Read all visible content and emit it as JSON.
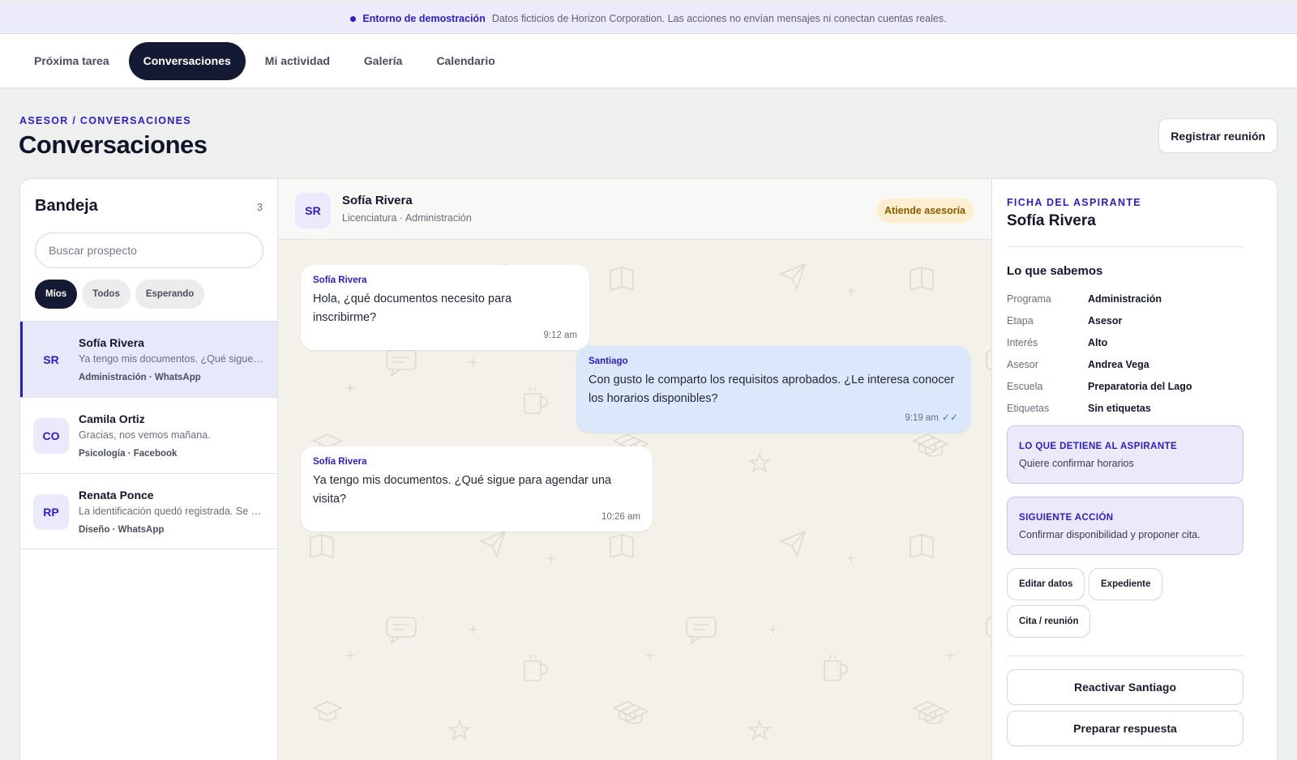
{
  "banner": {
    "label": "Entorno de demostración",
    "text": "Datos ficticios de Horizon Corporation. Las acciones no envían mensajes ni conectan cuentas reales."
  },
  "nav": {
    "tabs": [
      {
        "label": "Próxima tarea",
        "active": false
      },
      {
        "label": "Conversaciones",
        "active": true
      },
      {
        "label": "Mi actividad",
        "active": false
      },
      {
        "label": "Galería",
        "active": false
      },
      {
        "label": "Calendario",
        "active": false
      }
    ]
  },
  "header": {
    "breadcrumb": "ASESOR / CONVERSACIONES",
    "title": "Conversaciones",
    "meeting_button": "Registrar reunión"
  },
  "inbox": {
    "title": "Bandeja",
    "count": "3",
    "search_placeholder": "Buscar prospecto",
    "filters": [
      "Míos",
      "Todos",
      "Esperando"
    ],
    "active_filter": "Míos",
    "conversations": [
      {
        "initials": "SR",
        "name": "Sofía Rivera",
        "preview": "Ya tengo mis documentos. ¿Qué sigue para agendar una visita?",
        "meta": "Administración · WhatsApp",
        "active": true
      },
      {
        "initials": "CO",
        "name": "Camila Ortiz",
        "preview": "Gracias, nos vemos mañana.",
        "meta": "Psicología · Facebook",
        "active": false
      },
      {
        "initials": "RP",
        "name": "Renata Ponce",
        "preview": "La identificación quedó registrada. Se agradece.",
        "meta": "Diseño · WhatsApp",
        "active": false
      }
    ]
  },
  "chat": {
    "initials": "SR",
    "name": "Sofía Rivera",
    "subtitle": "Licenciatura · Administración",
    "status": "Atiende asesoría",
    "messages": [
      {
        "sender": "Sofía Rivera",
        "text": "Hola, ¿qué documentos necesito para inscribirme?",
        "time": "9:12 am",
        "direction": "in"
      },
      {
        "sender": "Santiago",
        "text": "Con gusto le comparto los requisitos aprobados. ¿Le interesa conocer los horarios disponibles?",
        "time": "9:19 am",
        "direction": "out",
        "read": true
      },
      {
        "sender": "Sofía Rivera",
        "text": "Ya tengo mis documentos. ¿Qué sigue para agendar una visita?",
        "time": "10:26 am",
        "direction": "in"
      }
    ]
  },
  "profile": {
    "label": "FICHA DEL ASPIRANTE",
    "name": "Sofía Rivera",
    "section_title": "Lo que sabemos",
    "facts": [
      {
        "key": "Programa",
        "value": "Administración"
      },
      {
        "key": "Etapa",
        "value": "Asesor"
      },
      {
        "key": "Interés",
        "value": "Alto"
      },
      {
        "key": "Asesor",
        "value": "Andrea Vega"
      },
      {
        "key": "Escuela",
        "value": "Preparatoria del Lago"
      },
      {
        "key": "Etiquetas",
        "value": "Sin etiquetas"
      }
    ],
    "blocker": {
      "title": "LO QUE DETIENE AL ASPIRANTE",
      "text": "Quiere confirmar horarios"
    },
    "next_action": {
      "title": "SIGUIENTE ACCIÓN",
      "text": "Confirmar disponibilidad y proponer cita."
    },
    "buttons": {
      "edit": "Editar datos",
      "file": "Expediente",
      "appointment": "Cita / reunión"
    },
    "reactivate": "Reactivar Santiago",
    "prepare": "Preparar respuesta"
  },
  "colors": {
    "accent": "#2d1cc8",
    "dark": "#141a33",
    "outgoing_bubble": "#dbe8fb",
    "status_badge": "#fbefcf"
  }
}
